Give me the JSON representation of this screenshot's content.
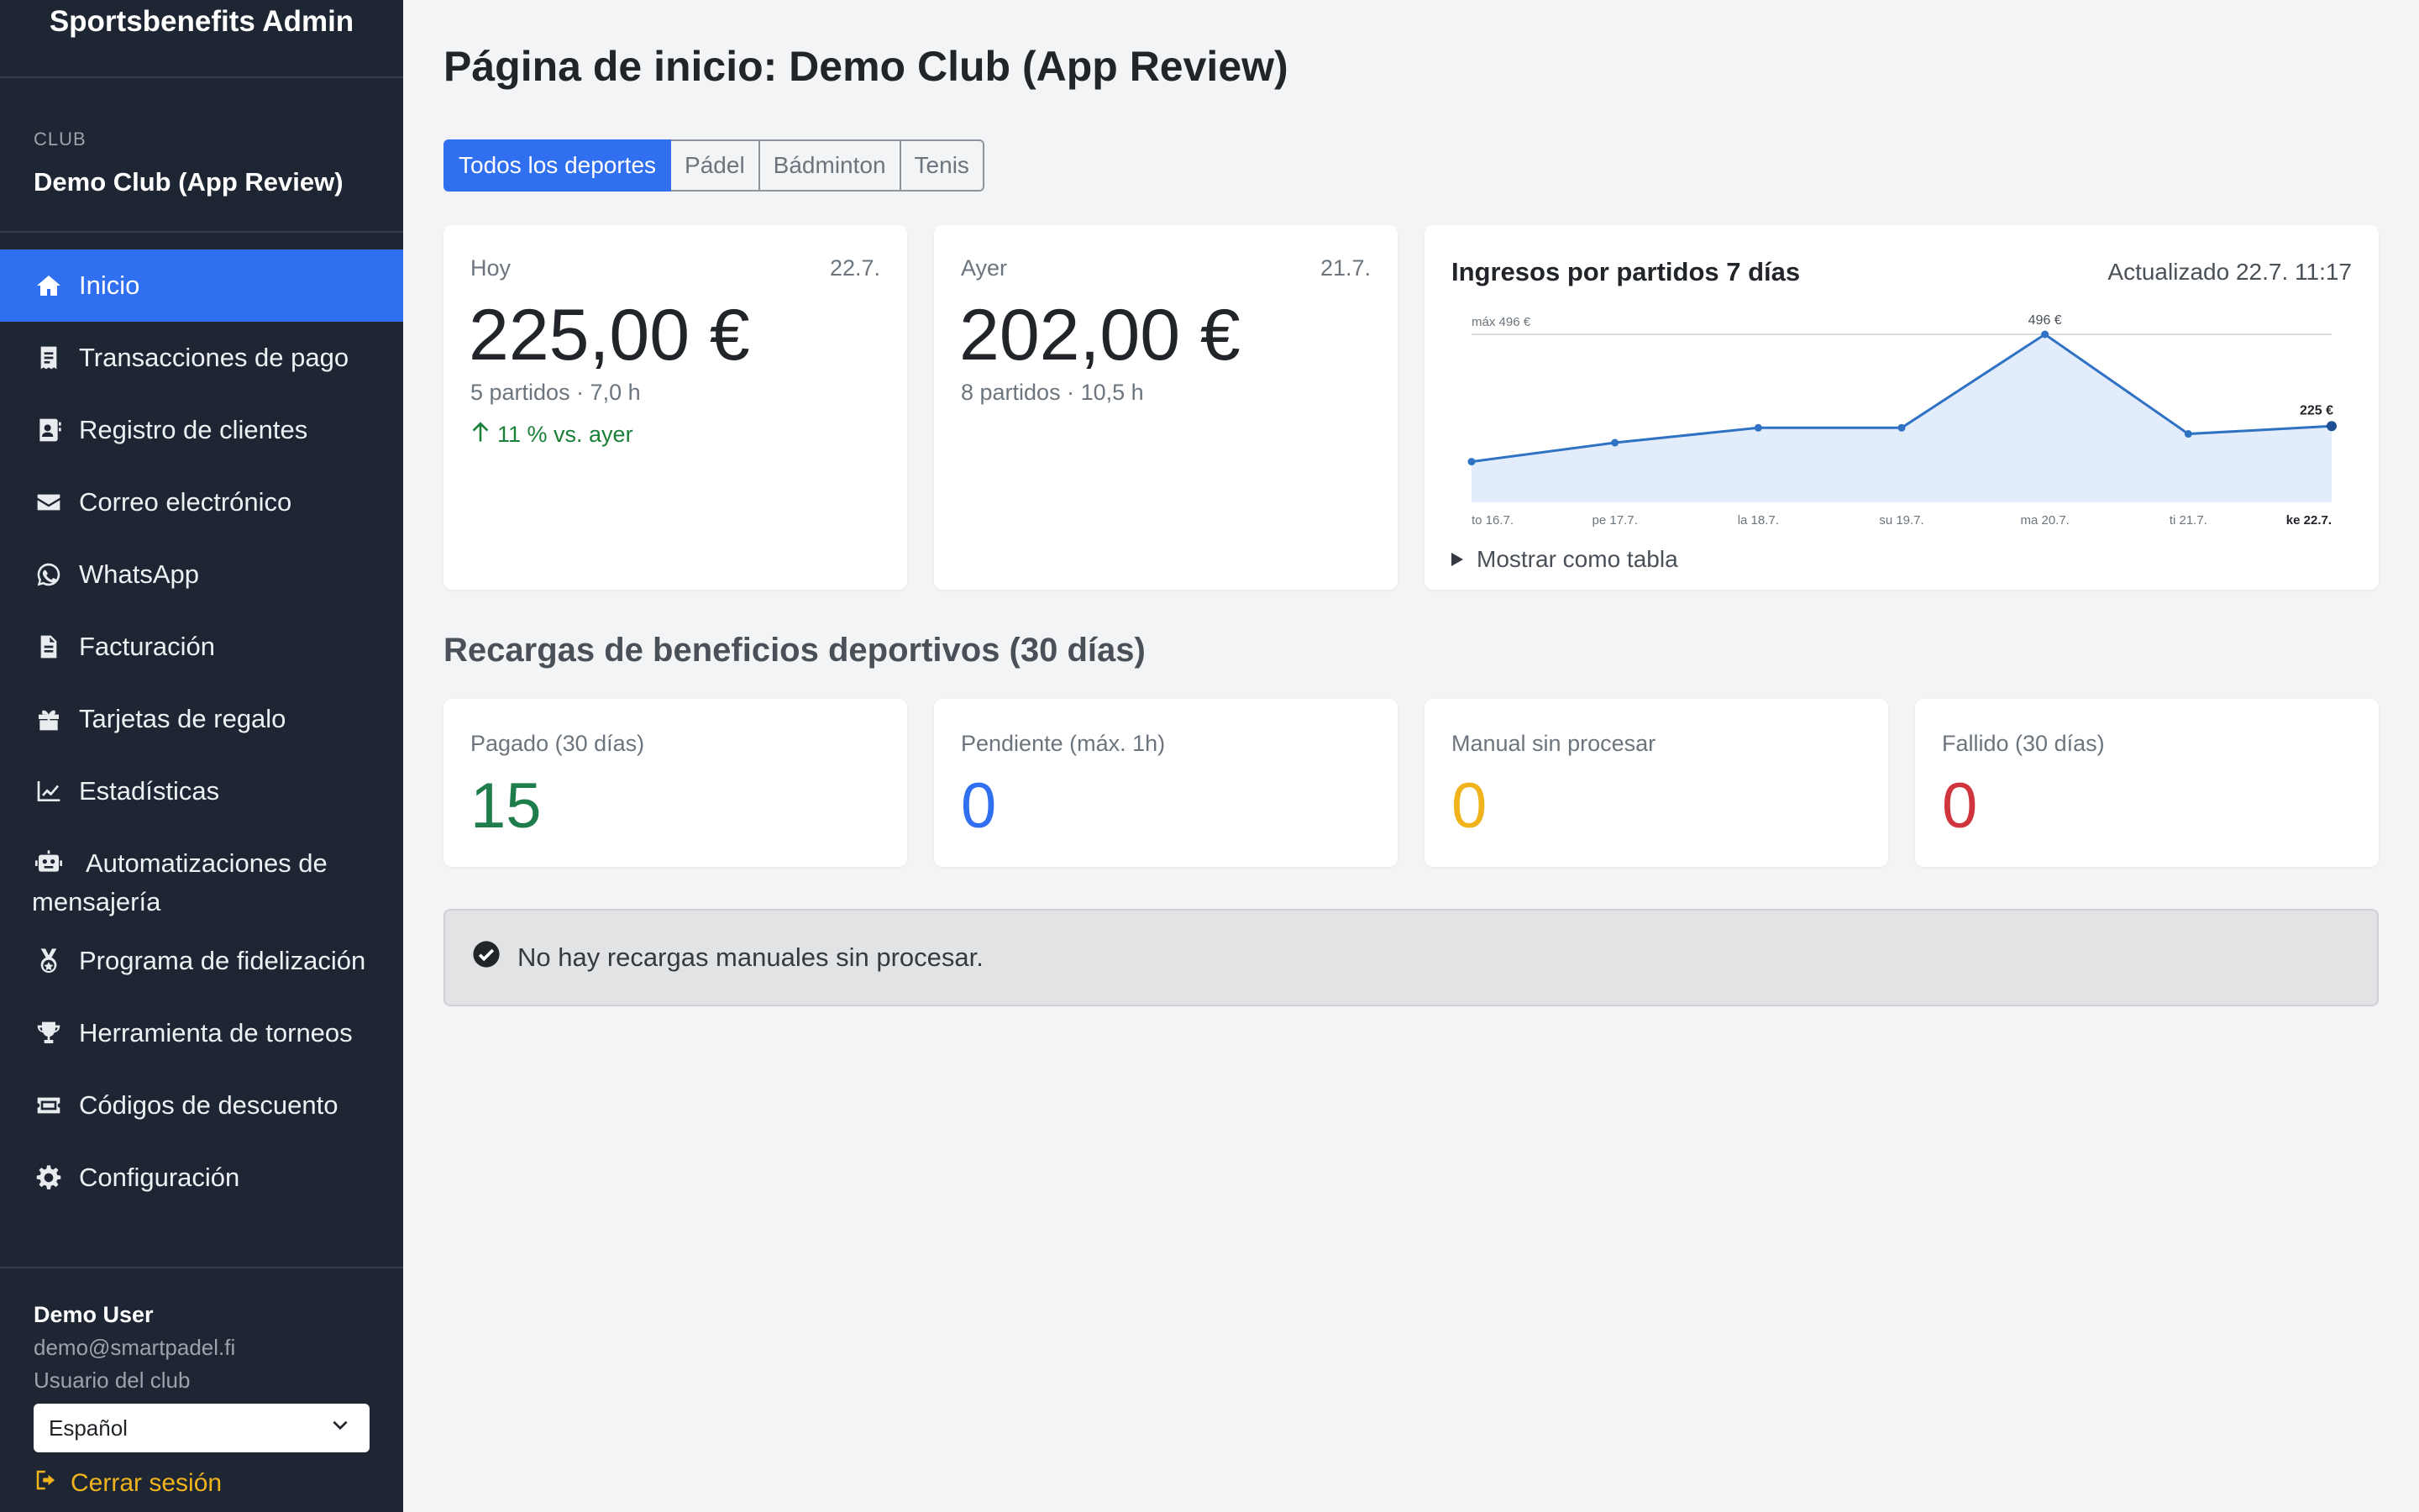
{
  "app": {
    "title": "Sportsbenefits Admin"
  },
  "club": {
    "caption": "CLUB",
    "name": "Demo Club (App Review)"
  },
  "sidebar": {
    "items": [
      {
        "label": "Inicio",
        "icon": "home-icon",
        "active": true
      },
      {
        "label": "Transacciones de pago",
        "icon": "receipt-icon"
      },
      {
        "label": "Registro de clientes",
        "icon": "contact-card-icon"
      },
      {
        "label": "Correo electrónico",
        "icon": "envelope-icon"
      },
      {
        "label": "WhatsApp",
        "icon": "whatsapp-icon"
      },
      {
        "label": "Facturación",
        "icon": "invoice-icon"
      },
      {
        "label": "Tarjetas de regalo",
        "icon": "gift-icon"
      },
      {
        "label": "Estadísticas",
        "icon": "chart-line-icon"
      },
      {
        "label": "Automatizaciones de mensajería",
        "icon": "robot-icon"
      },
      {
        "label": "Programa de fidelización",
        "icon": "medal-icon"
      },
      {
        "label": "Herramienta de torneos",
        "icon": "trophy-icon"
      },
      {
        "label": "Códigos de descuento",
        "icon": "ticket-icon"
      },
      {
        "label": "Configuración",
        "icon": "gear-icon"
      }
    ]
  },
  "user": {
    "name": "Demo User",
    "email": "demo@smartpadel.fi",
    "role": "Usuario del club",
    "language": "Español",
    "logout_label": "Cerrar sesión"
  },
  "page": {
    "title": "Página de inicio: Demo Club (App Review)"
  },
  "sport_tabs": [
    {
      "label": "Todos los deportes",
      "active": true
    },
    {
      "label": "Pádel"
    },
    {
      "label": "Bádminton"
    },
    {
      "label": "Tenis"
    }
  ],
  "today": {
    "label": "Hoy",
    "date": "22.7.",
    "value": "225,00 €",
    "sub": "5 partidos · 7,0 h",
    "trend": "11 % vs. ayer"
  },
  "yesterday": {
    "label": "Ayer",
    "date": "21.7.",
    "value": "202,00 €",
    "sub": "8 partidos · 10,5 h"
  },
  "revenue_chart": {
    "title": "Ingresos por partidos 7 días",
    "updated": "Actualizado 22.7. 11:17",
    "toggle_label": "Mostrar como tabla",
    "max_label": "máx 496 €",
    "peak_label": "496 €",
    "last_label": "225 €"
  },
  "chart_data": {
    "type": "area",
    "categories": [
      "to 16.7.",
      "pe 17.7.",
      "la 18.7.",
      "su 19.7.",
      "ma 20.7.",
      "ti 21.7.",
      "ke 22.7."
    ],
    "values": [
      120,
      176,
      220,
      220,
      496,
      202,
      225
    ],
    "ylim": [
      0,
      496
    ],
    "grid": false,
    "color": "#2f72c4"
  },
  "benefits": {
    "title": "Recargas de beneficios deportivos (30 días)",
    "stats": [
      {
        "label": "Pagado (30 días)",
        "value": "15",
        "color": "#1e7d4a"
      },
      {
        "label": "Pendiente (máx. 1h)",
        "value": "0",
        "color": "#2f6ff0"
      },
      {
        "label": "Manual sin procesar",
        "value": "0",
        "color": "#f0b31c"
      },
      {
        "label": "Fallido (30 días)",
        "value": "0",
        "color": "#d0343d"
      }
    ]
  },
  "notice": {
    "text": "No hay recargas manuales sin procesar."
  }
}
